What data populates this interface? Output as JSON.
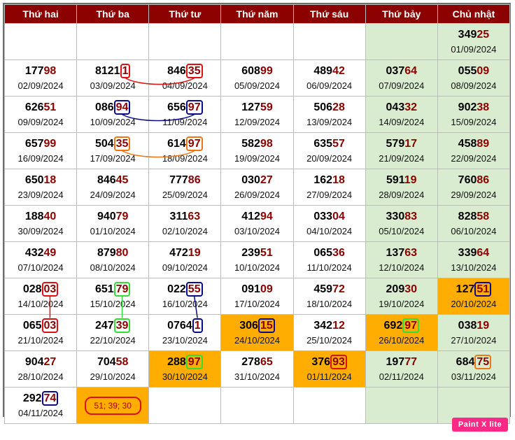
{
  "headers": [
    "Thứ hai",
    "Thứ ba",
    "Thứ tư",
    "Thứ năm",
    "Thứ sáu",
    "Thứ bảy",
    "Chủ nhật"
  ],
  "colors": {
    "header_bg": "#8b0000",
    "weekend_bg": "#d9ecd0",
    "highlight_bg": "#ffad00",
    "number_suffix": "#8b0000"
  },
  "logo": "Paint X lite",
  "rows": [
    [
      null,
      null,
      null,
      null,
      null,
      null,
      {
        "pre": "349",
        "suf": "25",
        "date": "01/09/2024"
      }
    ],
    [
      {
        "pre": "177",
        "suf": "98",
        "date": "02/09/2024"
      },
      {
        "pre": "8121",
        "suf": "1",
        "date": "03/09/2024",
        "ring": "red"
      },
      {
        "pre": "846",
        "suf": "35",
        "date": "04/09/2024",
        "ring": "red"
      },
      {
        "pre": "608",
        "suf": "99",
        "date": "05/09/2024"
      },
      {
        "pre": "489",
        "suf": "42",
        "date": "06/09/2024"
      },
      {
        "pre": "037",
        "suf": "64",
        "date": "07/09/2024"
      },
      {
        "pre": "055",
        "suf": "09",
        "date": "08/09/2024"
      }
    ],
    [
      {
        "pre": "626",
        "suf": "51",
        "date": "09/09/2024"
      },
      {
        "pre": "086",
        "suf": "94",
        "date": "10/09/2024",
        "ring": "blue"
      },
      {
        "pre": "656",
        "suf": "97",
        "date": "11/09/2024",
        "ring": "blue"
      },
      {
        "pre": "127",
        "suf": "59",
        "date": "12/09/2024"
      },
      {
        "pre": "506",
        "suf": "28",
        "date": "13/09/2024"
      },
      {
        "pre": "043",
        "suf": "32",
        "date": "14/09/2024"
      },
      {
        "pre": "902",
        "suf": "38",
        "date": "15/09/2024"
      }
    ],
    [
      {
        "pre": "657",
        "suf": "99",
        "date": "16/09/2024"
      },
      {
        "pre": "504",
        "suf": "35",
        "date": "17/09/2024",
        "ring": "orange"
      },
      {
        "pre": "614",
        "suf": "97",
        "date": "18/09/2024",
        "ring": "orange"
      },
      {
        "pre": "582",
        "suf": "98",
        "date": "19/09/2024"
      },
      {
        "pre": "635",
        "suf": "57",
        "date": "20/09/2024"
      },
      {
        "pre": "579",
        "suf": "17",
        "date": "21/09/2024"
      },
      {
        "pre": "458",
        "suf": "89",
        "date": "22/09/2024"
      }
    ],
    [
      {
        "pre": "650",
        "suf": "18",
        "date": "23/09/2024"
      },
      {
        "pre": "846",
        "suf": "45",
        "date": "24/09/2024"
      },
      {
        "pre": "777",
        "suf": "86",
        "date": "25/09/2024"
      },
      {
        "pre": "030",
        "suf": "27",
        "date": "26/09/2024"
      },
      {
        "pre": "162",
        "suf": "18",
        "date": "27/09/2024"
      },
      {
        "pre": "591",
        "suf": "19",
        "date": "28/09/2024"
      },
      {
        "pre": "760",
        "suf": "86",
        "date": "29/09/2024"
      }
    ],
    [
      {
        "pre": "188",
        "suf": "40",
        "date": "30/09/2024"
      },
      {
        "pre": "940",
        "suf": "79",
        "date": "01/10/2024"
      },
      {
        "pre": "311",
        "suf": "63",
        "date": "02/10/2024"
      },
      {
        "pre": "412",
        "suf": "94",
        "date": "03/10/2024"
      },
      {
        "pre": "033",
        "suf": "04",
        "date": "04/10/2024"
      },
      {
        "pre": "330",
        "suf": "83",
        "date": "05/10/2024"
      },
      {
        "pre": "828",
        "suf": "58",
        "date": "06/10/2024"
      }
    ],
    [
      {
        "pre": "432",
        "suf": "49",
        "date": "07/10/2024"
      },
      {
        "pre": "879",
        "suf": "80",
        "date": "08/10/2024"
      },
      {
        "pre": "472",
        "suf": "19",
        "date": "09/10/2024"
      },
      {
        "pre": "239",
        "suf": "51",
        "date": "10/10/2024"
      },
      {
        "pre": "065",
        "suf": "36",
        "date": "11/10/2024"
      },
      {
        "pre": "137",
        "suf": "63",
        "date": "12/10/2024"
      },
      {
        "pre": "339",
        "suf": "64",
        "date": "13/10/2024"
      }
    ],
    [
      {
        "pre": "028",
        "suf": "03",
        "date": "14/10/2024",
        "ring": "red"
      },
      {
        "pre": "651",
        "suf": "79",
        "date": "15/10/2024",
        "ring": "green"
      },
      {
        "pre": "022",
        "suf": "55",
        "date": "16/10/2024",
        "ring": "blue"
      },
      {
        "pre": "091",
        "suf": "09",
        "date": "17/10/2024"
      },
      {
        "pre": "459",
        "suf": "72",
        "date": "18/10/2024"
      },
      {
        "pre": "209",
        "suf": "30",
        "date": "19/10/2024"
      },
      {
        "pre": "127",
        "suf": "51",
        "date": "20/10/2024",
        "ring": "blue",
        "hl": true
      }
    ],
    [
      {
        "pre": "065",
        "suf": "03",
        "date": "21/10/2024",
        "ring": "red"
      },
      {
        "pre": "247",
        "suf": "39",
        "date": "22/10/2024",
        "ring": "green"
      },
      {
        "pre": "0764",
        "suf": "1",
        "date": "23/10/2024",
        "ring": "blue"
      },
      {
        "pre": "306",
        "suf": "15",
        "date": "24/10/2024",
        "ring": "blue",
        "hl": true
      },
      {
        "pre": "342",
        "suf": "12",
        "date": "25/10/2024"
      },
      {
        "pre": "692",
        "suf": "97",
        "date": "26/10/2024",
        "ring": "green",
        "hl": true
      },
      {
        "pre": "038",
        "suf": "19",
        "date": "27/10/2024"
      }
    ],
    [
      {
        "pre": "904",
        "suf": "27",
        "date": "28/10/2024"
      },
      {
        "pre": "704",
        "suf": "58",
        "date": "29/10/2024"
      },
      {
        "pre": "288",
        "suf": "97",
        "date": "30/10/2024",
        "ring": "green",
        "hl": true
      },
      {
        "pre": "278",
        "suf": "65",
        "date": "31/10/2024"
      },
      {
        "pre": "376",
        "suf": "93",
        "date": "01/11/2024",
        "ring": "red",
        "hl": true
      },
      {
        "pre": "197",
        "suf": "77",
        "date": "02/11/2024"
      },
      {
        "pre": "684",
        "suf": "75",
        "date": "03/11/2024",
        "ring": "orange"
      }
    ],
    [
      {
        "pre": "292",
        "suf": "74",
        "date": "04/11/2024",
        "ring": "blue"
      },
      {
        "note": "51; 39; 30",
        "hl": true
      },
      null,
      null,
      null,
      null,
      null
    ]
  ]
}
